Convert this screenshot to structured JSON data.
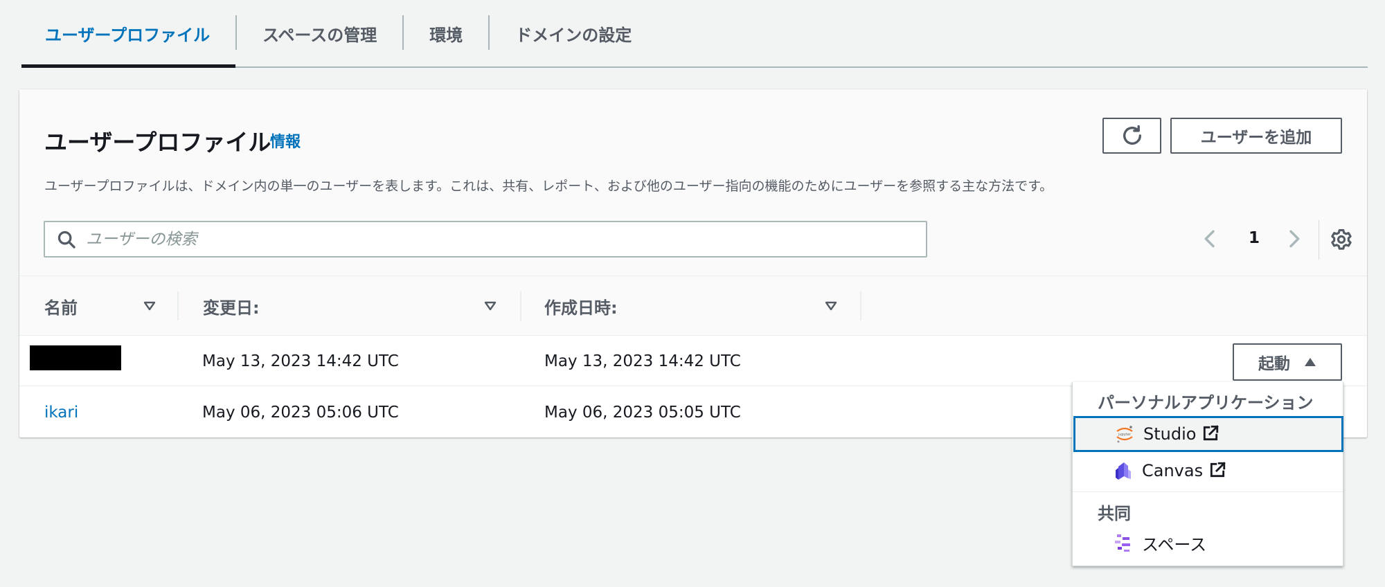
{
  "tabs": [
    {
      "label": "ユーザープロファイル",
      "active": true
    },
    {
      "label": "スペースの管理",
      "active": false
    },
    {
      "label": "環境",
      "active": false
    },
    {
      "label": "ドメインの設定",
      "active": false
    }
  ],
  "panel": {
    "title": "ユーザープロファイル",
    "info_label": "情報",
    "description": "ユーザープロファイルは、ドメイン内の単一のユーザーを表します。これは、共有、レポート、および他のユーザー指向の機能のためにユーザーを参照する主な方法です。",
    "add_user_label": "ユーザーを追加"
  },
  "search": {
    "placeholder": "ユーザーの検索",
    "value": ""
  },
  "pagination": {
    "current_page": "1"
  },
  "table": {
    "columns": [
      "名前",
      "変更日:",
      "作成日時:"
    ],
    "rows": [
      {
        "name": "",
        "name_redacted": true,
        "modified": "May 13, 2023 14:42 UTC",
        "created": "May 13, 2023 14:42 UTC",
        "launch_label": "起動"
      },
      {
        "name": "ikari",
        "name_redacted": false,
        "modified": "May 06, 2023 05:06 UTC",
        "created": "May 06, 2023 05:05 UTC"
      }
    ]
  },
  "launch_menu": {
    "groups": [
      {
        "label": "パーソナルアプリケーション",
        "items": [
          {
            "label": "Studio",
            "icon": "jupyter-icon",
            "external": true,
            "focused": true
          },
          {
            "label": "Canvas",
            "icon": "canvas-icon",
            "external": true,
            "focused": false
          }
        ]
      },
      {
        "label": "共同",
        "items": [
          {
            "label": "スペース",
            "icon": "spaces-icon",
            "external": false,
            "focused": false
          }
        ]
      }
    ]
  },
  "colors": {
    "link": "#0073bb",
    "text_secondary": "#545b64",
    "background": "#f2f3f3",
    "border": "#aab7b8"
  }
}
